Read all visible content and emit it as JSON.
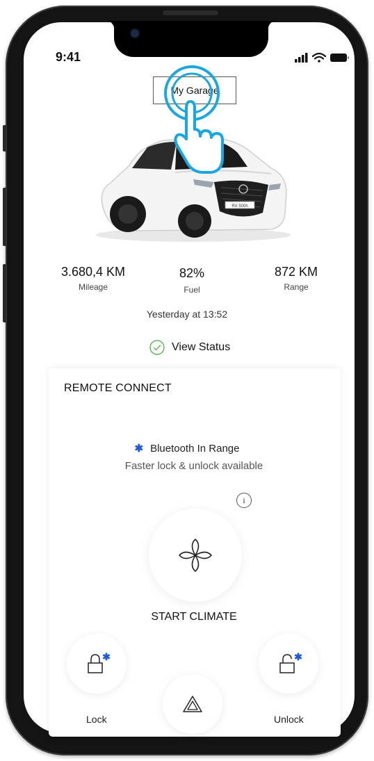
{
  "status_bar": {
    "time": "9:41"
  },
  "header": {
    "garage_label": "My Garage"
  },
  "stats": [
    {
      "value": "3.680,4 KM",
      "label": "Mileage"
    },
    {
      "value": "82%",
      "label": "Fuel"
    },
    {
      "value": "872 KM",
      "label": "Range"
    }
  ],
  "updated": "Yesterday at 13:52",
  "view_status": "View Status",
  "remote": {
    "title": "REMOTE CONNECT",
    "bt_status": "Bluetooth In Range",
    "bt_sub": "Faster lock & unlock available",
    "climate_label": "START CLIMATE",
    "lock_label": "Lock",
    "unlock_label": "Unlock"
  },
  "car_plate": "RX 500h",
  "colors": {
    "accent_blue": "#1f5bd6",
    "check_green": "#5cb85c",
    "tap_cyan": "#19a7e0"
  },
  "icons": [
    "signal-icon",
    "wifi-icon",
    "battery-icon",
    "tap-hand-icon",
    "check-circle-icon",
    "bluetooth-icon",
    "info-icon",
    "fan-icon",
    "lock-icon",
    "unlock-icon",
    "hazard-icon"
  ]
}
